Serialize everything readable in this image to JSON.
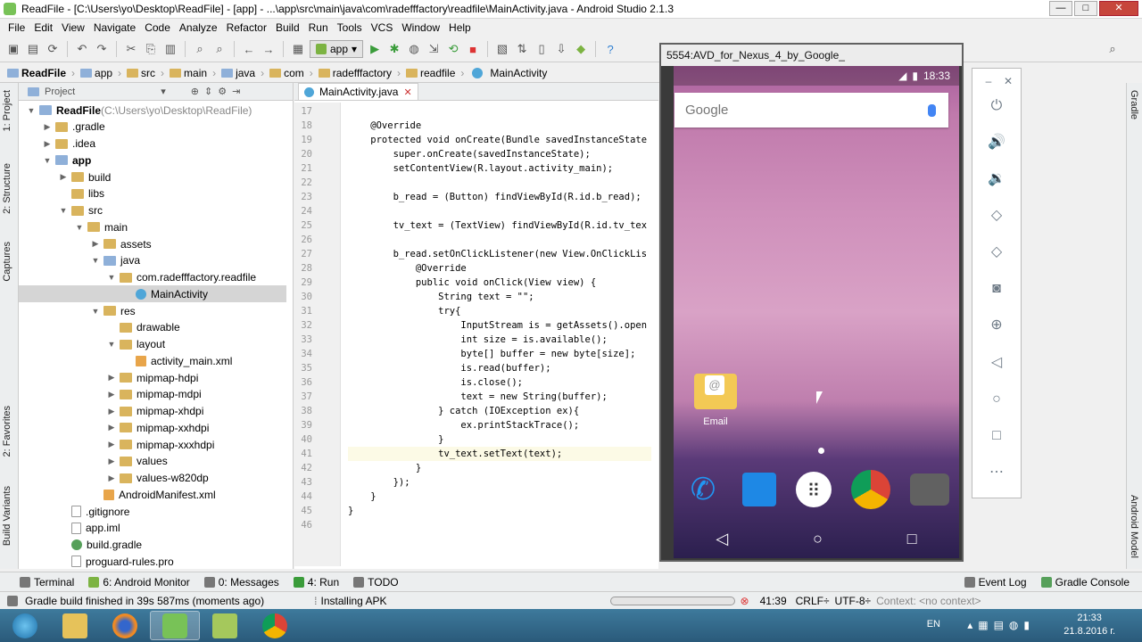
{
  "window": {
    "title": "ReadFile - [C:\\Users\\yo\\Desktop\\ReadFile] - [app] - ...\\app\\src\\main\\java\\com\\radefffactory\\readfile\\MainActivity.java - Android Studio 2.1.3"
  },
  "menu": [
    "File",
    "Edit",
    "View",
    "Navigate",
    "Code",
    "Analyze",
    "Refactor",
    "Build",
    "Run",
    "Tools",
    "VCS",
    "Window",
    "Help"
  ],
  "toolbar": {
    "run_config": "app"
  },
  "breadcrumb": [
    "ReadFile",
    "app",
    "src",
    "main",
    "java",
    "com",
    "radefffactory",
    "readfile",
    "MainActivity"
  ],
  "left_tabs": [
    "1: Project",
    "2: Structure",
    "Captures",
    "2: Favorites",
    "Build Variants"
  ],
  "project_panel": {
    "title": "Project",
    "tree": [
      {
        "label": "ReadFile",
        "extra": " (C:\\Users\\yo\\Desktop\\ReadFile)",
        "depth": 0,
        "arrow": "down",
        "icon": "folder-blue",
        "bold": true
      },
      {
        "label": ".gradle",
        "depth": 1,
        "arrow": "right",
        "icon": "folder"
      },
      {
        "label": ".idea",
        "depth": 1,
        "arrow": "right",
        "icon": "folder"
      },
      {
        "label": "app",
        "depth": 1,
        "arrow": "down",
        "icon": "folder-blue",
        "bold": true
      },
      {
        "label": "build",
        "depth": 2,
        "arrow": "right",
        "icon": "folder"
      },
      {
        "label": "libs",
        "depth": 2,
        "arrow": "",
        "icon": "folder"
      },
      {
        "label": "src",
        "depth": 2,
        "arrow": "down",
        "icon": "folder"
      },
      {
        "label": "main",
        "depth": 3,
        "arrow": "down",
        "icon": "folder"
      },
      {
        "label": "assets",
        "depth": 4,
        "arrow": "right",
        "icon": "folder"
      },
      {
        "label": "java",
        "depth": 4,
        "arrow": "down",
        "icon": "folder-blue"
      },
      {
        "label": "com.radefffactory.readfile",
        "depth": 5,
        "arrow": "down",
        "icon": "folder"
      },
      {
        "label": "MainActivity",
        "depth": 6,
        "arrow": "",
        "icon": "class",
        "selected": true
      },
      {
        "label": "res",
        "depth": 4,
        "arrow": "down",
        "icon": "folder"
      },
      {
        "label": "drawable",
        "depth": 5,
        "arrow": "",
        "icon": "folder"
      },
      {
        "label": "layout",
        "depth": 5,
        "arrow": "down",
        "icon": "folder"
      },
      {
        "label": "activity_main.xml",
        "depth": 6,
        "arrow": "",
        "icon": "xml"
      },
      {
        "label": "mipmap-hdpi",
        "depth": 5,
        "arrow": "right",
        "icon": "folder"
      },
      {
        "label": "mipmap-mdpi",
        "depth": 5,
        "arrow": "right",
        "icon": "folder"
      },
      {
        "label": "mipmap-xhdpi",
        "depth": 5,
        "arrow": "right",
        "icon": "folder"
      },
      {
        "label": "mipmap-xxhdpi",
        "depth": 5,
        "arrow": "right",
        "icon": "folder"
      },
      {
        "label": "mipmap-xxxhdpi",
        "depth": 5,
        "arrow": "right",
        "icon": "folder"
      },
      {
        "label": "values",
        "depth": 5,
        "arrow": "right",
        "icon": "folder"
      },
      {
        "label": "values-w820dp",
        "depth": 5,
        "arrow": "right",
        "icon": "folder"
      },
      {
        "label": "AndroidManifest.xml",
        "depth": 4,
        "arrow": "",
        "icon": "xml"
      },
      {
        "label": ".gitignore",
        "depth": 2,
        "arrow": "",
        "icon": "file"
      },
      {
        "label": "app.iml",
        "depth": 2,
        "arrow": "",
        "icon": "file"
      },
      {
        "label": "build.gradle",
        "depth": 2,
        "arrow": "",
        "icon": "gradle"
      },
      {
        "label": "proguard-rules.pro",
        "depth": 2,
        "arrow": "",
        "icon": "file"
      }
    ]
  },
  "editor": {
    "tab": "MainActivity.java",
    "lines": [
      {
        "n": "17",
        "text": ""
      },
      {
        "n": "18",
        "text": "    @Override"
      },
      {
        "n": "19",
        "text": "    protected void onCreate(Bundle savedInstanceState"
      },
      {
        "n": "20",
        "text": "        super.onCreate(savedInstanceState);"
      },
      {
        "n": "21",
        "text": "        setContentView(R.layout.activity_main);"
      },
      {
        "n": "22",
        "text": ""
      },
      {
        "n": "23",
        "text": "        b_read = (Button) findViewById(R.id.b_read);"
      },
      {
        "n": "24",
        "text": ""
      },
      {
        "n": "25",
        "text": "        tv_text = (TextView) findViewById(R.id.tv_tex"
      },
      {
        "n": "26",
        "text": ""
      },
      {
        "n": "27",
        "text": "        b_read.setOnClickListener(new View.OnClickLis"
      },
      {
        "n": "28",
        "text": "            @Override"
      },
      {
        "n": "29",
        "text": "            public void onClick(View view) {"
      },
      {
        "n": "30",
        "text": "                String text = \"\";"
      },
      {
        "n": "31",
        "text": "                try{"
      },
      {
        "n": "32",
        "text": "                    InputStream is = getAssets().open"
      },
      {
        "n": "33",
        "text": "                    int size = is.available();"
      },
      {
        "n": "34",
        "text": "                    byte[] buffer = new byte[size];"
      },
      {
        "n": "35",
        "text": "                    is.read(buffer);"
      },
      {
        "n": "36",
        "text": "                    is.close();"
      },
      {
        "n": "37",
        "text": "                    text = new String(buffer);"
      },
      {
        "n": "38",
        "text": "                } catch (IOException ex){"
      },
      {
        "n": "39",
        "text": "                    ex.printStackTrace();"
      },
      {
        "n": "40",
        "text": "                }"
      },
      {
        "n": "41",
        "text": "                tv_text.setText(text);"
      },
      {
        "n": "42",
        "text": "            }"
      },
      {
        "n": "43",
        "text": "        });"
      },
      {
        "n": "44",
        "text": "    }"
      },
      {
        "n": "45",
        "text": "}"
      },
      {
        "n": "46",
        "text": ""
      }
    ],
    "current_line": "41"
  },
  "emulator": {
    "title": "5554:AVD_for_Nexus_4_by_Google_",
    "time": "18:33",
    "search_logo": "Google",
    "email_label": "Email"
  },
  "bottom_tools": {
    "left": [
      "Terminal",
      "6: Android Monitor",
      "0: Messages",
      "4: Run",
      "TODO"
    ],
    "right": [
      "Event Log",
      "Gradle Console"
    ]
  },
  "statusbar": {
    "message": "Gradle build finished in 39s 587ms (moments ago)",
    "task": "Installing APK",
    "position": "41:39",
    "line_sep": "CRLF÷",
    "encoding": "UTF-8÷",
    "context": "Context: <no context>"
  },
  "taskbar": {
    "lang": "EN",
    "time": "21:33",
    "date": "21.8.2016 г."
  }
}
